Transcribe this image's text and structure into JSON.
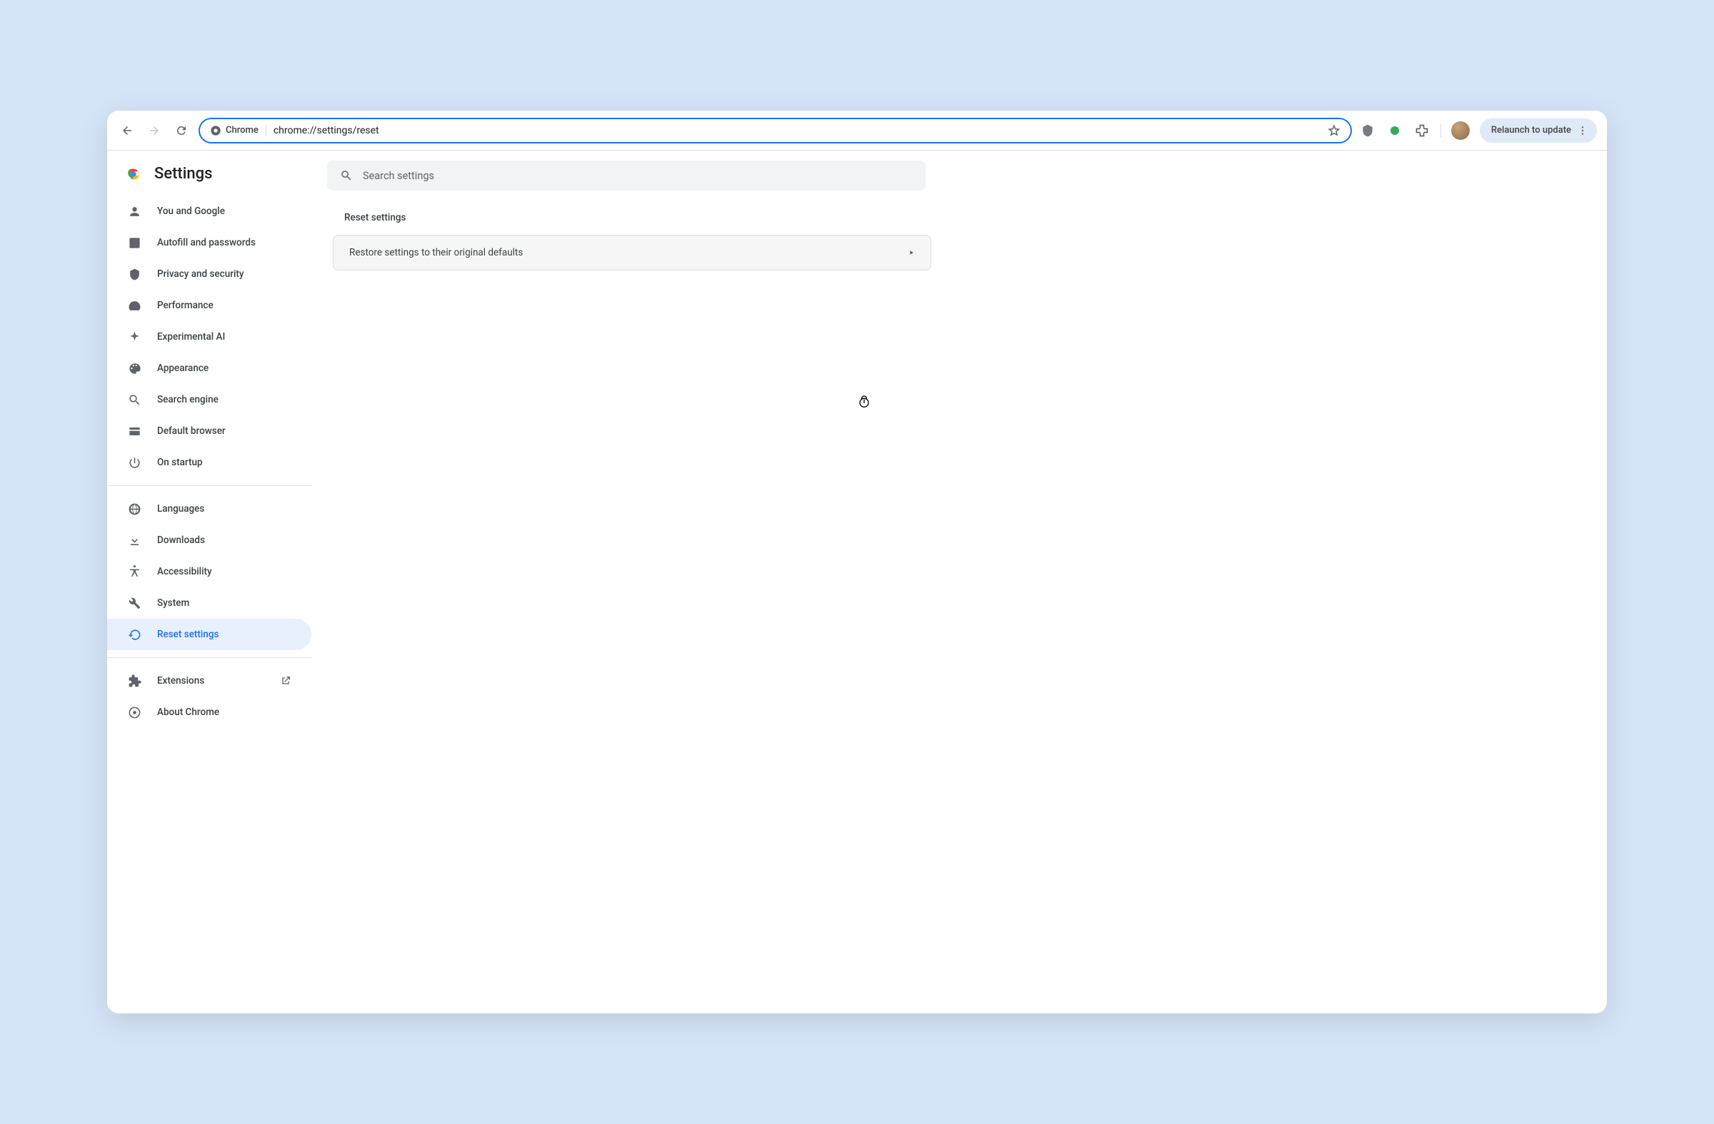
{
  "toolbar": {
    "chip_label": "Chrome",
    "url": "chrome://settings/reset",
    "relaunch_label": "Relaunch to update"
  },
  "header": {
    "title": "Settings"
  },
  "search": {
    "placeholder": "Search settings"
  },
  "sidebar": {
    "items_primary": [
      {
        "icon": "person",
        "label": "You and Google"
      },
      {
        "icon": "assignment",
        "label": "Autofill and passwords"
      },
      {
        "icon": "security",
        "label": "Privacy and security"
      },
      {
        "icon": "speed",
        "label": "Performance"
      },
      {
        "icon": "sparkle",
        "label": "Experimental AI"
      },
      {
        "icon": "palette",
        "label": "Appearance"
      },
      {
        "icon": "search",
        "label": "Search engine"
      },
      {
        "icon": "browser",
        "label": "Default browser"
      },
      {
        "icon": "power",
        "label": "On startup"
      }
    ],
    "items_secondary": [
      {
        "icon": "globe",
        "label": "Languages"
      },
      {
        "icon": "download",
        "label": "Downloads"
      },
      {
        "icon": "accessibility",
        "label": "Accessibility"
      },
      {
        "icon": "build",
        "label": "System"
      },
      {
        "icon": "restore",
        "label": "Reset settings",
        "active": true
      }
    ],
    "items_tertiary": [
      {
        "icon": "extension",
        "label": "Extensions",
        "external": true
      },
      {
        "icon": "chrome",
        "label": "About Chrome"
      }
    ]
  },
  "main": {
    "section_title": "Reset settings",
    "restore_label": "Restore settings to their original defaults"
  }
}
